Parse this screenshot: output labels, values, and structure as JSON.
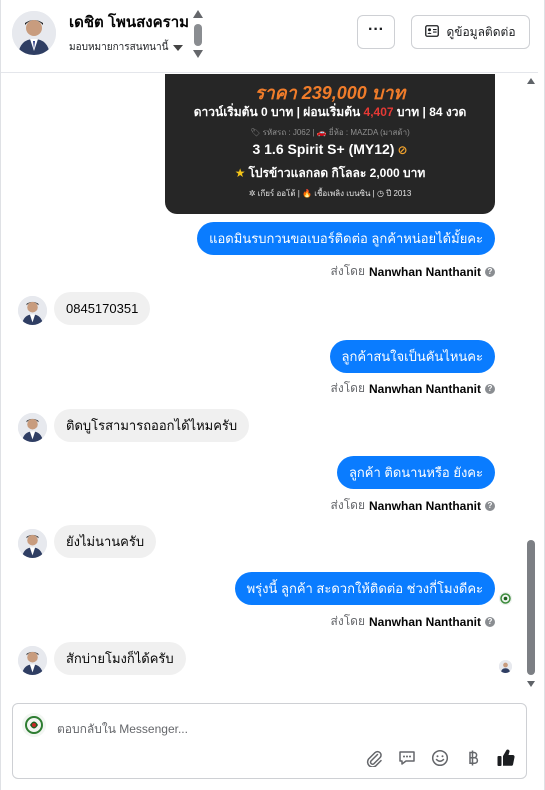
{
  "header": {
    "contact_name": "เดชิต โพนสงคราม",
    "assigned_label": "มอบหมายการสนทนานี้",
    "more_label": "···",
    "view_contact_label": "ดูข้อมูลติดต่อ"
  },
  "product_card": {
    "price": "ราคา 239,000 บาท",
    "terms_prefix": "ดาวน์เริ่มต้น 0 บาท | ผ่อนเริ่มต้น ",
    "installment": "4,407",
    "terms_suffix": " บาท | 84 งวด",
    "meta": "🏷 รหัสรถ : J062 | 🚗 ยี่ห้อ : MAZDA (มาสด้า)",
    "model": "3 1.6 Spirit S+ (MY12)",
    "promo": "โปรข้าวแลกลด กิโลละ 2,000 บาท",
    "specs": "✲ เกียร์ ออโต้   |   🔥 เชื้อเพลิง เบนซิน   |   ◷ ปี 2013"
  },
  "messages": [
    {
      "direction": "outgoing",
      "text": "แอดมินรบกวนขอเบอร์ติดต่อ ลูกค้าหน่อยได้มั้ยคะ",
      "sent_by_prefix": "ส่งโดย",
      "sent_by": "Nanwhan Nanthanit"
    },
    {
      "direction": "incoming",
      "text": "0845170351"
    },
    {
      "direction": "outgoing",
      "text": "ลูกค้าสนใจเป็นคันไหนคะ",
      "sent_by_prefix": "ส่งโดย",
      "sent_by": "Nanwhan Nanthanit"
    },
    {
      "direction": "incoming",
      "text": "ติดบูโรสามารถออกได้ไหมครับ"
    },
    {
      "direction": "outgoing",
      "text": "ลูกค้า ติดนานหรือ ยังคะ",
      "sent_by_prefix": "ส่งโดย",
      "sent_by": "Nanwhan Nanthanit"
    },
    {
      "direction": "incoming",
      "text": "ยังไม่นานครับ"
    },
    {
      "direction": "outgoing",
      "text": "พรุ่งนี้ ลูกค้า สะดวกให้ติดต่อ ช่วงกี่โมงดีคะ",
      "sent_by_prefix": "ส่งโดย",
      "sent_by": "Nanwhan Nanthanit"
    },
    {
      "direction": "incoming",
      "text": "สักบ่ายโมงก็ได้ครับ"
    }
  ],
  "composer": {
    "placeholder": "ตอบกลับใน Messenger..."
  },
  "icons": [
    "attachment-icon",
    "saved-replies-icon",
    "emoji-icon",
    "baht-icon",
    "like-icon",
    "help-icon",
    "contact-card-icon"
  ],
  "colors": {
    "outgoing_bubble": "#0a7cff",
    "incoming_bubble": "#f0f0f0",
    "price": "#f07c2a",
    "card_bg": "#262626"
  }
}
